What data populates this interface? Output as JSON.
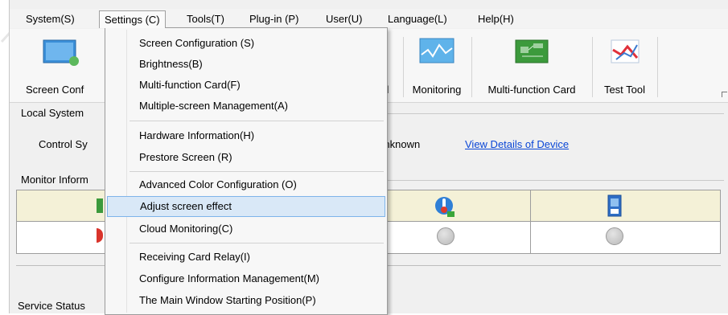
{
  "menubar": {
    "items": [
      {
        "label": "System(S)",
        "open": false
      },
      {
        "label": "Settings (C)",
        "open": true
      },
      {
        "label": "Tools(T)",
        "open": false
      },
      {
        "label": "Plug-in (P)",
        "open": false
      },
      {
        "label": "User(U)",
        "open": false
      },
      {
        "label": "Language(L)",
        "open": false
      },
      {
        "label": "Help(H)",
        "open": false
      }
    ]
  },
  "toolbar": {
    "screen_config_label": "Screen Conf",
    "control_label": "rol",
    "monitoring_label": "Monitoring",
    "multifunction_label": "Multi-function Card",
    "test_tool_label": "Test Tool"
  },
  "local_system": {
    "title": "Local System",
    "control_system_label": "Control Sy",
    "status_value": "Unknown",
    "view_details_link": "View Details of Device"
  },
  "monitor": {
    "title": "Monitor Inform"
  },
  "service_status": {
    "title": "Service Status"
  },
  "settings_menu": {
    "groups": [
      [
        "Screen Configuration (S)",
        "Brightness(B)",
        "Multi-function Card(F)",
        "Multiple-screen Management(A)"
      ],
      [
        "Hardware Information(H)",
        "Prestore Screen (R)"
      ],
      [
        "Advanced Color Configuration (O)",
        "Adjust screen effect",
        "Cloud Monitoring(C)"
      ],
      [
        "Receiving Card Relay(I)",
        "Configure Information Management(M)",
        "The Main Window Starting Position(P)"
      ]
    ],
    "highlighted": "Adjust screen effect"
  },
  "colors": {
    "highlight_bg": "#d9e8f7",
    "highlight_border": "#7eb4ea",
    "link": "#0a46d6"
  }
}
